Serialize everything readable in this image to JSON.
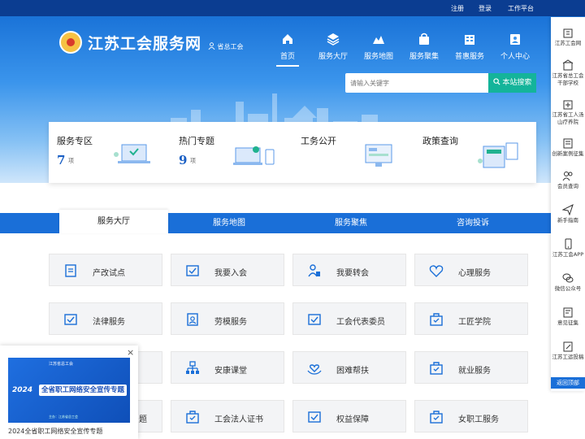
{
  "topbar": {
    "links": [
      "注册",
      "登录",
      "工作平台"
    ]
  },
  "header": {
    "site_title": "江苏工会服务网",
    "region": "省总工会",
    "nav": [
      {
        "label": "首页",
        "icon": "home-icon"
      },
      {
        "label": "服务大厅",
        "icon": "layers-icon"
      },
      {
        "label": "服务地图",
        "icon": "map-icon"
      },
      {
        "label": "服务聚集",
        "icon": "bag-icon"
      },
      {
        "label": "普惠服务",
        "icon": "building-icon"
      },
      {
        "label": "个人中心",
        "icon": "person-card-icon"
      }
    ],
    "active_nav": "首页"
  },
  "search": {
    "placeholder": "请输入关键字",
    "button": "本站搜索"
  },
  "cards": [
    {
      "title": "服务专区",
      "count": "7",
      "unit": "项"
    },
    {
      "title": "热门专题",
      "count": "9",
      "unit": "项"
    },
    {
      "title": "工务公开",
      "count": "",
      "unit": ""
    },
    {
      "title": "政策查询",
      "count": "",
      "unit": ""
    }
  ],
  "sidebar": {
    "items": [
      "江苏工会网",
      "江苏省总工会干部学校",
      "江苏省工人汤山疗养院",
      "创新案例征集",
      "会员查询",
      "新手指南",
      "江苏工会APP",
      "微信公众号",
      "意见征集",
      "江苏工运投稿"
    ],
    "back_top": "返回顶部"
  },
  "tabs": [
    "服务大厅",
    "服务地图",
    "服务聚焦",
    "咨询投诉"
  ],
  "services": [
    [
      "产改试点",
      "我要入会",
      "我要转会",
      "心理服务"
    ],
    [
      "法律服务",
      "劳模服务",
      "工会代表委员",
      "工匠学院"
    ],
    [
      "",
      "安康课堂",
      "困难帮扶",
      "就业服务"
    ],
    [
      "题",
      "工会法人证书",
      "权益保障",
      "女职工服务"
    ]
  ],
  "popup": {
    "banner_top": "江苏省总工会",
    "banner_year": "2024",
    "banner_title": "全省职工网络安全宣传专题",
    "banner_foot": "主办：江苏省总工会",
    "caption": "2024全省职工网络安全宣传专题",
    "close": "×"
  },
  "colors": {
    "primary": "#1a6fd8",
    "search_button": "#14b49a",
    "topbar": "#0b3d91",
    "accent": "#1a5fc4"
  }
}
